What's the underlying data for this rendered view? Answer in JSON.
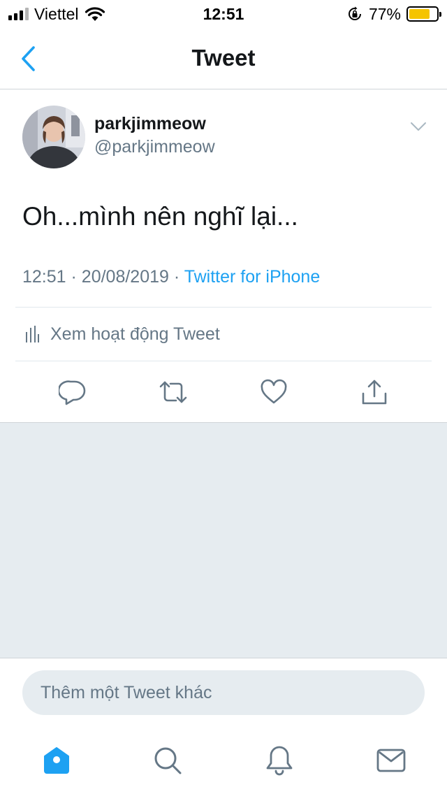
{
  "status_bar": {
    "carrier": "Viettel",
    "time": "12:51",
    "battery_percent": "77%",
    "battery_level": 0.77,
    "icons": [
      "signal-icon",
      "wifi-icon",
      "rotation-lock-icon",
      "battery-icon"
    ]
  },
  "nav": {
    "title": "Tweet",
    "back_icon": "chevron-left-icon"
  },
  "tweet": {
    "display_name": "parkjimmeow",
    "handle": "@parkjimmeow",
    "text": "Oh...mình nên nghĩ lại...",
    "time": "12:51",
    "separator": "·",
    "date": "20/08/2019",
    "source": "Twitter for iPhone",
    "activity_label": "Xem hoạt động Tweet",
    "actions": [
      "reply-icon",
      "retweet-icon",
      "like-icon",
      "share-icon"
    ]
  },
  "composer": {
    "placeholder": "Thêm một Tweet khác"
  },
  "tabbar": {
    "items": [
      "home-icon",
      "search-icon",
      "notifications-icon",
      "messages-icon"
    ],
    "active": "home-icon"
  },
  "colors": {
    "accent": "#1da1f2",
    "secondary_text": "#657786",
    "primary_text": "#14171a",
    "background_grey": "#e6ecf0",
    "battery": "#f5c400"
  }
}
